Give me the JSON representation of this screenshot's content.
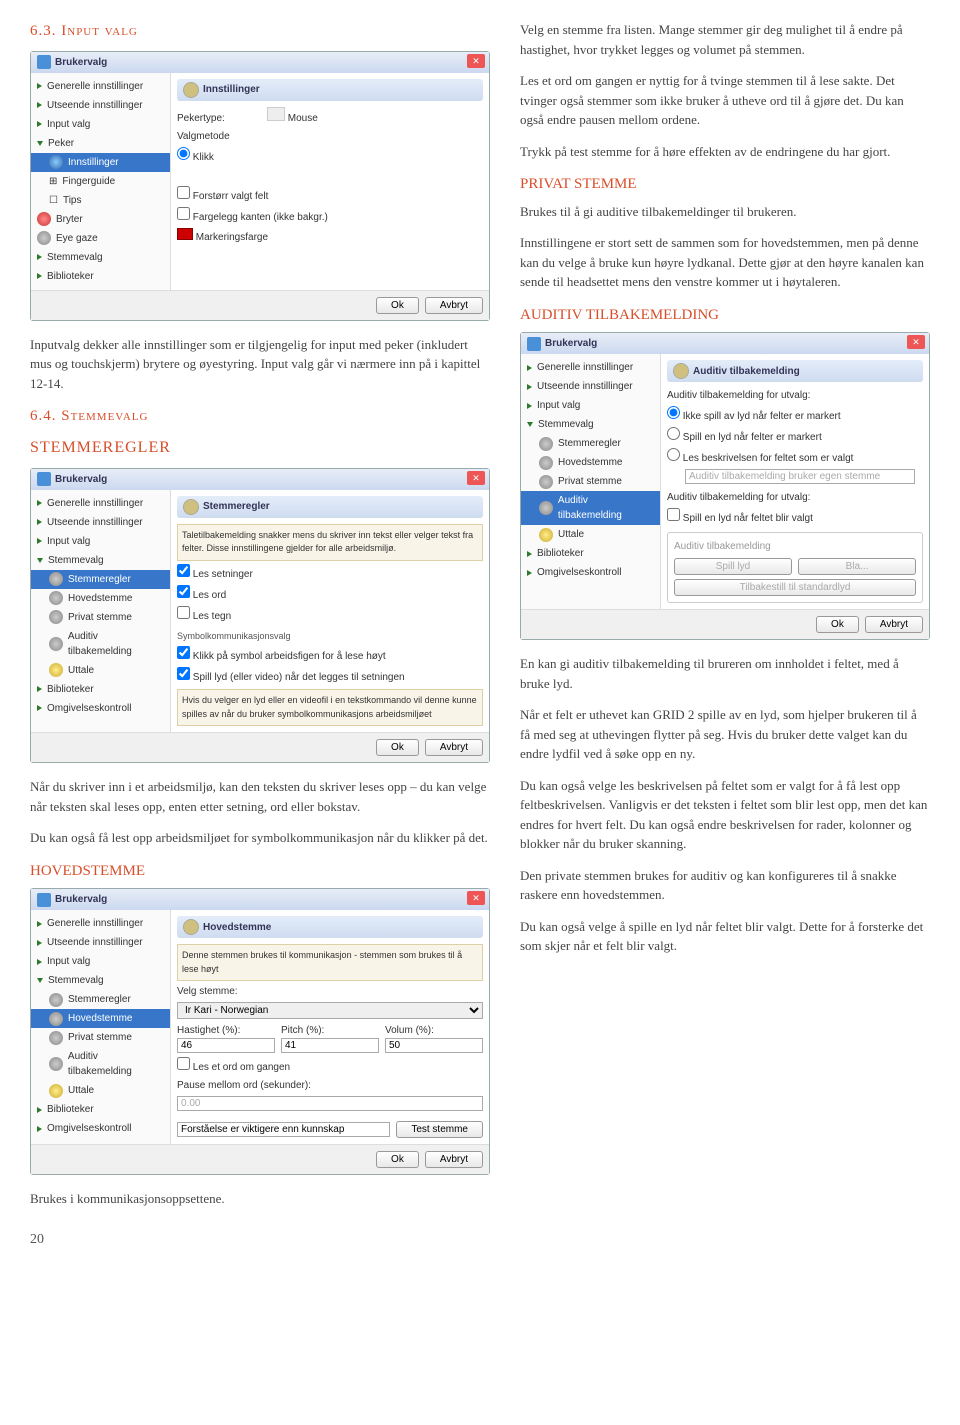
{
  "s63": {
    "num": "6.3. Input valg",
    "body": "Inputvalg dekker alle innstillinger som er tilgjengelig for input med peker (inkludert mus og touchskjerm) brytere og øyestyring. Input valg går vi nærmere inn på i kapittel 12-14."
  },
  "s64": {
    "num": "6.4. Stemmevalg",
    "title": "STEMMEREGLER",
    "body1": "Når du skriver inn i et arbeidsmiljø, kan den teksten du skriver leses opp – du kan velge når teksten skal leses opp, enten etter setning, ord eller bokstav.",
    "body2": "Du kan også få lest opp arbeidsmiljøet for symbolkommunikasjon når du klikker på det."
  },
  "hoved": "HOVEDSTEMME",
  "right": {
    "p1": "Velg en stemme fra listen. Mange stemmer gir deg mulighet til å endre på hastighet, hvor trykket legges og volumet på stemmen.",
    "p2": "Les et ord om gangen er nyttig for å tvinge stemmen til å lese sakte. Det tvinger også stemmer som ikke bruker å utheve ord til å gjøre det. Du kan også endre pausen mellom ordene.",
    "p3": "Trykk på test stemme for å høre effekten av de endringene du har gjort.",
    "privat": "PRIVAT STEMME",
    "p4": "Brukes til å gi auditive tilbakemeldinger til brukeren.",
    "p5": "Innstillingene er stort sett de sammen som for hovedstemmen, men på denne kan du velge å bruke kun høyre lydkanal. Dette gjør at den høyre kanalen kan sende til headsettet mens den venstre kommer ut i høytaleren.",
    "auditiv": "AUDITIV TILBAKEMELDING",
    "p6": "En kan gi auditiv tilbakemelding til brureren om innholdet i feltet, med å bruke lyd.",
    "p7": "Når et felt er uthevet kan GRID 2 spille av en lyd, som hjelper brukeren til å få med seg at uthevingen flytter på seg. Hvis du bruker dette valget kan du endre lydfil ved å søke opp en ny.",
    "p8": "Du kan også velge les beskrivelsen på feltet som er valgt for å få lest opp feltbeskrivelsen. Vanligvis er det teksten i feltet som blir lest opp, men det kan endres for hvert felt. Du kan også endre beskrivelsen for rader, kolonner og blokker når du bruker skanning.",
    "p9": "Den private stemmen brukes for auditiv og kan konfigureres til å snakke raskere enn hovedstemmen.",
    "p10": "Du kan også velge å spille en lyd når feltet blir valgt. Dette for å forsterke det som skjer når et felt blir valgt."
  },
  "bottom": "Brukes i kommunikasjonsoppsettene.",
  "page": "20",
  "win": {
    "title": "Brukervalg",
    "ok": "Ok",
    "cancel": "Avbryt",
    "side": {
      "gen": "Generelle innstillinger",
      "uts": "Utseende innstillinger",
      "inp": "Input valg",
      "peker": "Peker",
      "innst": "Innstillinger",
      "finger": "Fingerguide",
      "tips": "Tips",
      "bryter": "Bryter",
      "eye": "Eye gaze",
      "stemme": "Stemmevalg",
      "bib": "Biblioteker",
      "stemreg": "Stemmeregler",
      "hoved": "Hovedstemme",
      "privat": "Privat stemme",
      "auditiv": "Auditiv tilbakemelding",
      "uttale": "Uttale",
      "omgiv": "Omgivelseskontroll"
    }
  },
  "win1": {
    "head": "Innstillinger",
    "pt": "Pekertype:",
    "mouse": "Mouse",
    "valg": "Valgmetode",
    "klikk": "Klikk",
    "forstorr": "Forstørr valgt felt",
    "farge": "Fargelegg kanten (ikke bakgr.)",
    "mark": "Markeringsfarge"
  },
  "win2": {
    "head": "Stemmeregler",
    "desc": "Taletilbakemelding snakker mens du skriver inn tekst eller velger tekst fra felter. Disse innstillingene gjelder for alle arbeidsmiljø.",
    "les_set": "Les setninger",
    "les_ord": "Les ord",
    "les_tegn": "Les tegn",
    "sym": "Symbolkommunikasjonsvalg",
    "s1": "Klikk på symbol arbeidsfigen for å lese høyt",
    "s2": "Spill lyd (eller video) når det legges til setningen",
    "hint": "Hvis du velger en lyd eller en videofil i en tekstkommando vil denne kunne spilles av når du bruker symbolkommunikasjons arbeidsmiljøet"
  },
  "win3": {
    "head": "Hovedstemme",
    "desc": "Denne stemmen brukes til kommunikasjon - stemmen som brukes til å lese høyt",
    "velg": "Velg stemme:",
    "voice": "Ir Kari - Norwegian",
    "hast": "Hastighet (%):",
    "pitch": "Pitch (%):",
    "vol": "Volum (%):",
    "v1": "46",
    "v2": "41",
    "v3": "50",
    "les": "Les et ord om gangen",
    "pause": "Pause mellom ord (sekunder):",
    "p": "0.00",
    "forst": "Forståelse er viktigere enn kunnskap",
    "test": "Test stemme"
  },
  "win4": {
    "head": "Auditiv tilbakemelding",
    "g1": "Auditiv tilbakemelding for utvalg:",
    "r1": "Ikke spill av lyd når felter er markert",
    "r2": "Spill en lyd når felter er markert",
    "r3": "Les beskrivelsen for feltet som er valgt",
    "hint": "Auditiv tilbakemelding bruker egen stemme",
    "g2": "Auditiv tilbakemelding for utvalg:",
    "c1": "Spill en lyd når feltet blir valgt",
    "g3": "Auditiv tilbakemelding",
    "b1": "Spill lyd",
    "b2": "Bla...",
    "b3": "Tilbakestill til standardlyd"
  }
}
